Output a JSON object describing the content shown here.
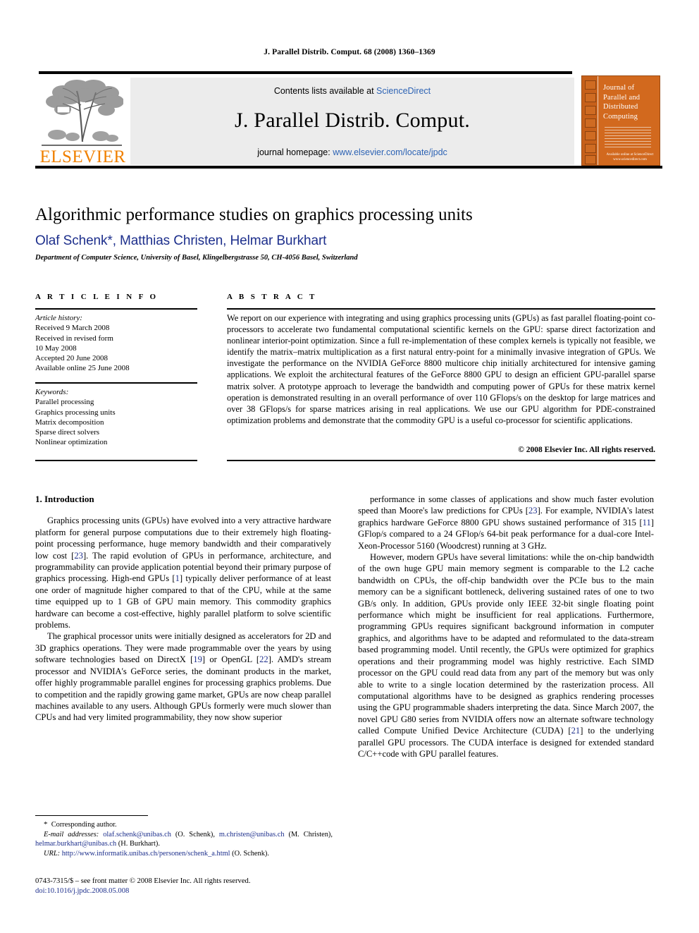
{
  "running_head": "J. Parallel Distrib. Comput. 68 (2008) 1360–1369",
  "masthead": {
    "contents_prefix": "Contents lists available at ",
    "sciencedirect": "ScienceDirect",
    "journal_name": "J. Parallel Distrib. Comput.",
    "homepage_prefix": "journal homepage: ",
    "homepage_url": "www.elsevier.com/locate/jpdc",
    "publisher": "ELSEVIER",
    "cover_title": "Journal of Parallel and Distributed Computing",
    "cover_footer": "Available online at ScienceDirect www.sciencedirect.com",
    "colors": {
      "elsevier_orange": "#F08000",
      "cover_orange": "#d2691e",
      "link_blue": "#2d63b4",
      "author_blue": "#1d2f8c"
    }
  },
  "article": {
    "title": "Algorithmic performance studies on graphics processing units",
    "authors": "Olaf Schenk*, Matthias Christen, Helmar Burkhart",
    "affiliation": "Department of Computer Science, University of Basel, Klingelbergstrasse 50, CH-4056 Basel, Switzerland"
  },
  "info": {
    "heading": "A R T I C L E   I N F O",
    "history_label": "Article history:",
    "history": [
      "Received 9 March 2008",
      "Received in revised form",
      "10 May 2008",
      "Accepted 20 June 2008",
      "Available online 25 June 2008"
    ],
    "keywords_label": "Keywords:",
    "keywords": [
      "Parallel processing",
      "Graphics processing units",
      "Matrix decomposition",
      "Sparse direct solvers",
      "Nonlinear optimization"
    ]
  },
  "abstract": {
    "heading": "A B S T R A C T",
    "text": "We report on our experience with integrating and using graphics processing units (GPUs) as fast parallel floating-point co-processors to accelerate two fundamental computational scientific kernels on the GPU: sparse direct factorization and nonlinear interior-point optimization. Since a full re-implementation of these complex kernels is typically not feasible, we identify the matrix–matrix multiplication as a first natural entry-point for a minimally invasive integration of GPUs. We investigate the performance on the NVIDIA GeForce 8800 multicore chip initially architectured for intensive gaming applications. We exploit the architectural features of the GeForce 8800 GPU to design an efficient GPU-parallel sparse matrix solver. A prototype approach to leverage the bandwidth and computing power of GPUs for these matrix kernel operation is demonstrated resulting in an overall performance of over 110 GFlops/s on the desktop for large matrices and over 38 GFlops/s for sparse matrices arising in real applications. We use our GPU algorithm for PDE-constrained optimization problems and demonstrate that the commodity GPU is a useful co-processor for scientific applications.",
    "copyright": "© 2008 Elsevier Inc. All rights reserved."
  },
  "body": {
    "section_number_title": "1. Introduction",
    "left_paragraphs": [
      "Graphics processing units (GPUs) have evolved into a very attractive hardware platform for general purpose computations due to their extremely high floating-point processing performance, huge memory bandwidth and their comparatively low cost [23]. The rapid evolution of GPUs in performance, architecture, and programmability can provide application potential beyond their primary purpose of graphics processing. High-end GPUs [1] typically deliver performance of at least one order of magnitude higher compared to that of the CPU, while at the same time equipped up to 1 GB of GPU main memory. This commodity graphics hardware can become a cost-effective, highly parallel platform to solve scientific problems.",
      "The graphical processor units were initially designed as accelerators for 2D and 3D graphics operations. They were made programmable over the years by using software technologies based on DirectX [19] or OpenGL [22]. AMD's stream processor and NVIDIA's GeForce series, the dominant products in the market, offer highly programmable parallel engines for processing graphics problems. Due to competition and the rapidly growing game market, GPUs are now cheap parallel machines available to any users. Although GPUs formerly were much slower than CPUs and had very limited programmability, they now show superior"
    ],
    "right_paragraphs": [
      "performance in some classes of applications and show much faster evolution speed than Moore's law predictions for CPUs [23]. For example, NVIDIA's latest graphics hardware GeForce 8800 GPU shows sustained performance of 315 [11] GFlop/s compared to a 24 GFlop/s 64-bit peak performance for a dual-core Intel-Xeon-Processor 5160 (Woodcrest) running at 3 GHz.",
      "However, modern GPUs have several limitations: while the on-chip bandwidth of the own huge GPU main memory segment is comparable to the L2 cache bandwidth on CPUs, the off-chip bandwidth over the PCIe bus to the main memory can be a significant bottleneck, delivering sustained rates of one to two GB/s only. In addition, GPUs provide only IEEE 32-bit single floating  point performance which might be insufficient for real applications. Furthermore, programming GPUs requires significant background information in computer graphics, and algorithms have to be adapted and reformulated to the data-stream based programming model. Until recently, the GPUs were optimized for graphics operations and their programming model was highly restrictive. Each SIMD processor on the GPU could read data from any part of the memory but was only able to write to a single location determined by the rasterization process. All computational algorithms have to be designed as graphics rendering processes using the GPU programmable shaders interpreting the data. Since March 2007, the novel GPU G80 series from NVIDIA offers now an alternate software technology called Compute Unified Device Architecture (CUDA) [21] to the underlying parallel GPU processors. The CUDA interface is designed for extended standard C/C++code with GPU parallel features."
    ],
    "reference_marks_left": [
      "23",
      "1",
      "19",
      "22"
    ],
    "reference_marks_right": [
      "23",
      "11",
      "21"
    ]
  },
  "footnotes": {
    "corresponding": "Corresponding author.",
    "email_label": "E-mail addresses:",
    "emails": [
      {
        "address": "olaf.schenk@unibas.ch",
        "name": "(O. Schenk)"
      },
      {
        "address": "m.christen@unibas.ch",
        "name": "(M. Christen)"
      },
      {
        "address": "helmar.burkhart@unibas.ch",
        "name": "(H. Burkhart)."
      }
    ],
    "url_label": "URL:",
    "url": "http://www.informatik.unibas.ch/personen/schenk_a.html",
    "url_name": "(O. Schenk).",
    "issn_line": "0743-7315/$ – see front matter © 2008 Elsevier Inc. All rights reserved.",
    "doi_label": "doi:",
    "doi": "10.1016/j.jpdc.2008.05.008"
  }
}
